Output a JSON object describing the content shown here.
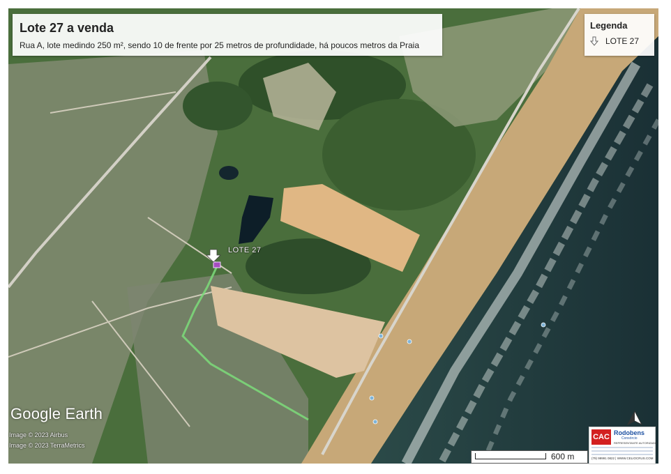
{
  "title": "Lote 27 a venda",
  "subtitle": "Rua A, lote medindo 250 m², sendo 10 de frente por 25 metros de profundidade, há poucos metros da Praia",
  "legend": {
    "title": "Legenda",
    "items": [
      {
        "icon": "down-arrow-icon",
        "label": "LOTE 27"
      }
    ]
  },
  "map": {
    "marker_label": "LOTE 27",
    "logo": "Google Earth",
    "credits": [
      "Image © 2023 Airbus",
      "Image © 2023 TerraMetrics"
    ],
    "scale_label": "600 m",
    "north_icon": "north-arrow-icon"
  },
  "advertiser": {
    "brand": "CAC",
    "company": "Rodobens",
    "company_sub": "Consórcio",
    "tagline": "REPRESENTANTE AUTORIZADO",
    "phone": "(79) 99991 0822",
    "website": "WWW.CELIOCRUS.COM"
  },
  "colors": {
    "ocean": "#1f3b3f",
    "sand": "#c7a878",
    "vegetation": "#3f6a36",
    "road": "#cfcdc4",
    "lot_marker": "#a64dbf",
    "route": "#7ddc7a"
  }
}
